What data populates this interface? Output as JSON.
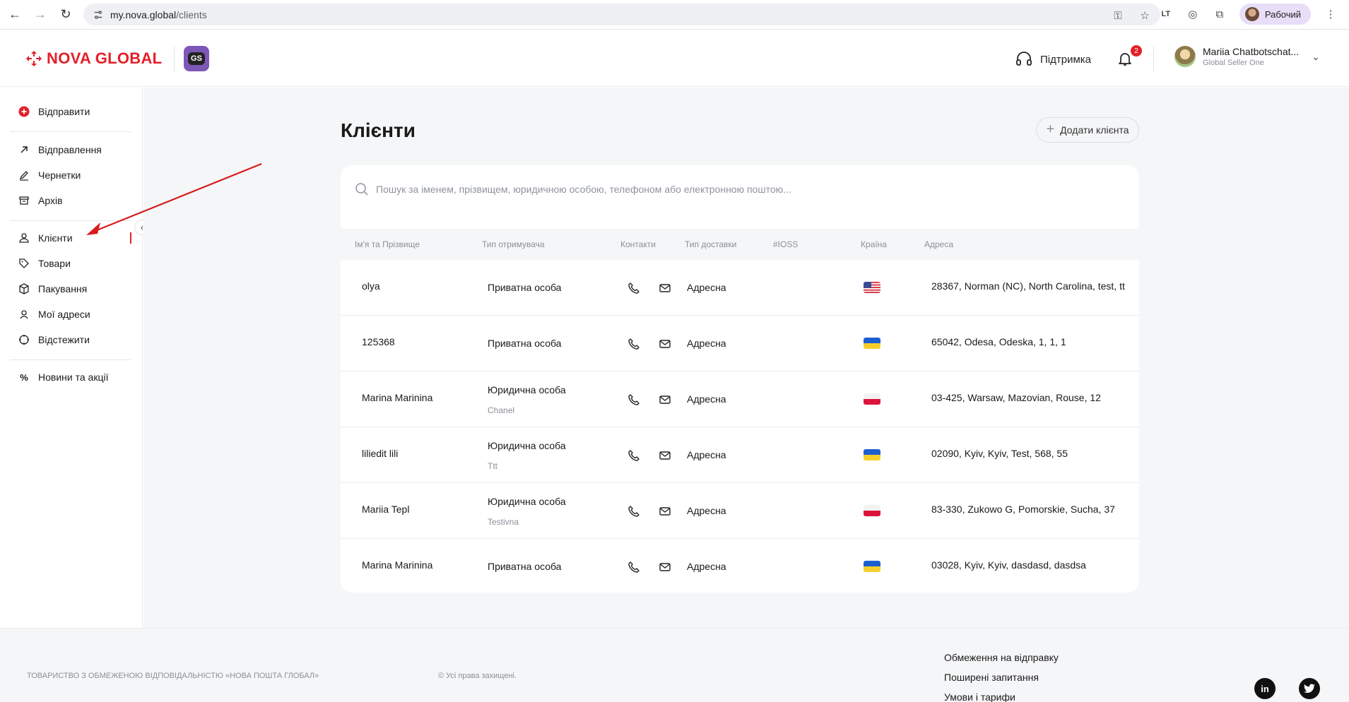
{
  "browser": {
    "url_host": "my.nova.global",
    "url_path": "/clients",
    "profile_label": "Рабочий"
  },
  "header": {
    "logo_text": "NOVA GLOBAL",
    "gs_badge": "GS",
    "support_label": "Підтримка",
    "notifications_count": "2",
    "user_name": "Mariia Chatbotschat...",
    "user_role": "Global Seller One"
  },
  "sidebar": {
    "send_label": "Відправити",
    "items": [
      {
        "label": "Відправлення",
        "icon": "arrow-up-right-icon"
      },
      {
        "label": "Чернетки",
        "icon": "edit-icon"
      },
      {
        "label": "Архів",
        "icon": "archive-icon"
      },
      {
        "label": "Клієнти",
        "icon": "users-icon"
      },
      {
        "label": "Товари",
        "icon": "tag-icon"
      },
      {
        "label": "Пакування",
        "icon": "box-icon"
      },
      {
        "label": "Мої адреси",
        "icon": "location-icon"
      },
      {
        "label": "Відстежити",
        "icon": "track-icon"
      },
      {
        "label": "Новини та акції",
        "icon": "percent-icon"
      }
    ],
    "active_index": 3
  },
  "main": {
    "title": "Клієнти",
    "add_button": "Додати клієнта",
    "search_placeholder": "Пошук за іменем, прізвищем, юридичною особою, телефоном або електронною поштою...",
    "columns": [
      "Ім'я та Прізвище",
      "Тип отримувача",
      "Контакти",
      "Тип доставки",
      "#IOSS",
      "Країна",
      "Адреса"
    ],
    "rows": [
      {
        "name": "olya",
        "type": "Приватна особа",
        "company": "",
        "delivery": "Адресна",
        "country": "us",
        "address": "28367, Norman (NC), North Carolina, test, tt"
      },
      {
        "name": "125368",
        "type": "Приватна особа",
        "company": "",
        "delivery": "Адресна",
        "country": "ua",
        "address": "65042, Odesa, Odeska, 1, 1, 1"
      },
      {
        "name": "Marina Marinina",
        "type": "Юридична особа",
        "company": "Chanel",
        "delivery": "Адресна",
        "country": "pl",
        "address": "03-425, Warsaw, Mazovian, Rouse, 12"
      },
      {
        "name": "liliedit lili",
        "type": "Юридична особа",
        "company": "Ttt",
        "delivery": "Адресна",
        "country": "ua",
        "address": "02090, Kyiv, Kyiv, Test, 568, 55"
      },
      {
        "name": "Mariia Tepl",
        "type": "Юридична особа",
        "company": "Testivna",
        "delivery": "Адресна",
        "country": "pl",
        "address": "83-330, Zukowo G, Pomorskie, Sucha, 37"
      },
      {
        "name": "Marina Marinina",
        "type": "Приватна особа",
        "company": "",
        "delivery": "Адресна",
        "country": "ua",
        "address": "03028, Kyiv, Kyiv, dasdasd, dasdsa"
      }
    ]
  },
  "footer": {
    "company": "ТОВАРИСТВО З ОБМЕЖЕНОЮ ВІДПОВІДАЛЬНІСТЮ «НОВА ПОШТА ГЛОБАЛ»",
    "rights": "© Усі права захищені.",
    "links": [
      "Обмеження на відправку",
      "Поширені запитання",
      "Умови і тарифи"
    ]
  },
  "colors": {
    "brand_red": "#e3202a",
    "gs_purple": "#7d57b6",
    "page_bg": "#f5f6f8"
  }
}
